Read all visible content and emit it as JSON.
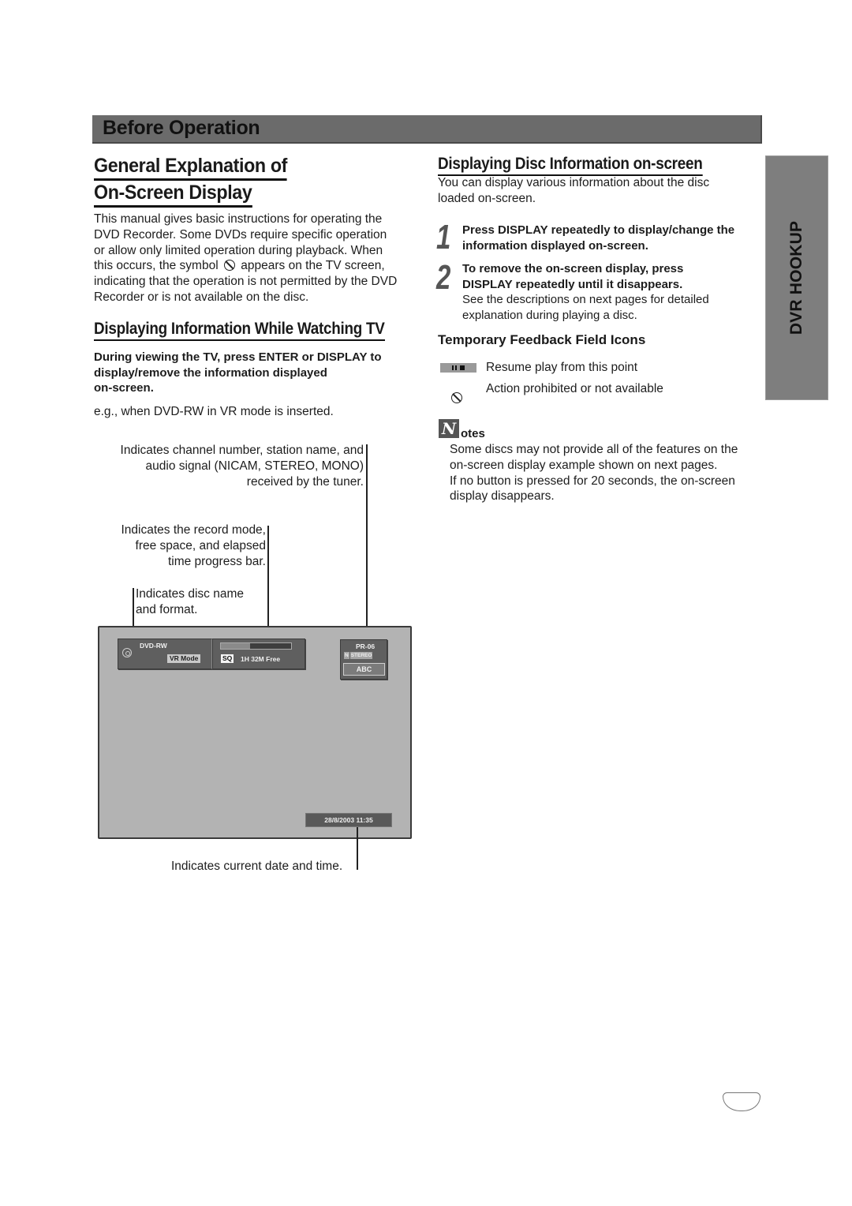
{
  "banner": {
    "title": "Before Operation"
  },
  "left": {
    "title_line1": "General Explanation of",
    "title_line2": "On-Screen Display",
    "intro_lines": [
      "This manual gives basic instructions for operating the",
      "DVD Recorder. Some DVDs require specific operation",
      "or allow only limited operation during playback. When",
      "this occurs, the symbol",
      "appears on the TV screen,",
      "indicating that the operation is not permitted by the DVD",
      "Recorder or is not available on the disc."
    ],
    "subsection_title": "Displaying Information While Watching TV",
    "instruction_lines": [
      "During viewing the TV, press ENTER or DISPLAY to",
      "display/remove the information displayed",
      "on-screen."
    ],
    "example_text": "e.g., when DVD-RW in VR mode is inserted.",
    "callouts": {
      "channel": [
        "Indicates channel number, station name, and",
        "audio signal (NICAM, STEREO, MONO)",
        "received by the tuner."
      ],
      "record_mode": [
        "Indicates the record mode,",
        "free space, and elapsed",
        "time progress bar."
      ],
      "disc": [
        "Indicates disc name",
        "and format."
      ],
      "datetime": "Indicates current date and time."
    },
    "osd": {
      "disc_format": "DVD-RW",
      "record_format": "VR Mode",
      "quality": "SQ",
      "free_space": "1H 32M Free",
      "progress_fraction": 0.42,
      "channel": "PR-06",
      "audio_prefix": "N",
      "audio_signal": "STEREO",
      "station": "ABC",
      "datetime": "28/8/2003  11:35"
    }
  },
  "right": {
    "title": "Displaying Disc Information on-screen",
    "intro_lines": [
      "You can display various information about the disc",
      "loaded on-screen."
    ],
    "steps": [
      {
        "number": "1",
        "lines": [
          "Press DISPLAY repeatedly to display/change the",
          "information displayed on-screen."
        ]
      },
      {
        "number": "2",
        "lines": [
          "To remove the on-screen display, press",
          "DISPLAY repeatedly until it disappears."
        ],
        "detail": [
          "See the descriptions on next pages for detailed",
          "explanation during playing a disc."
        ]
      }
    ],
    "feedback_title": "Temporary Feedback Field Icons",
    "feedback_icons": [
      {
        "icon": "resume-icon",
        "label": "Resume play from this point"
      },
      {
        "icon": "prohibited-icon",
        "label": "Action prohibited or not available"
      }
    ],
    "notes": {
      "icon_letter": "N",
      "title": "otes",
      "lines": [
        "Some discs may not provide all of the features on the",
        "on-screen display example shown on next pages.",
        "If no button is pressed for 20 seconds, the on-screen",
        "display disappears."
      ]
    }
  },
  "side_tab": {
    "label": "DVR HOOKUP"
  }
}
